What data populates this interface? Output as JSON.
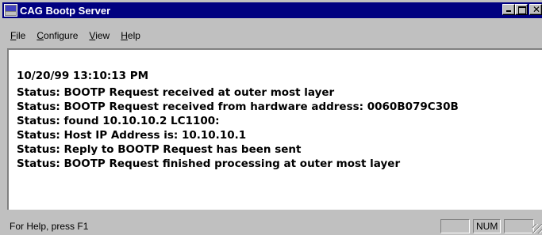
{
  "window": {
    "title": "CAG Bootp Server",
    "icon": "app-icon",
    "controls": {
      "minimize_icon": "minimize-icon",
      "maximize_icon": "maximize-icon",
      "close_label": "✕"
    }
  },
  "menu": {
    "items": [
      {
        "accel": "F",
        "rest": "ile"
      },
      {
        "accel": "C",
        "rest": "onfigure"
      },
      {
        "accel": "V",
        "rest": "iew"
      },
      {
        "accel": "H",
        "rest": "elp"
      }
    ]
  },
  "log": {
    "timestamp": "10/20/99 13:10:13 PM",
    "lines": [
      "Status: BOOTP Request received at outer most layer",
      "Status: BOOTP Request received from hardware address: 0060B079C30B",
      "Status: found 10.10.10.2 LC1100:",
      "Status: Host IP Address is: 10.10.10.1",
      "Status: Reply to BOOTP Request has been sent",
      "Status: BOOTP Request finished processing at outer most layer"
    ]
  },
  "statusbar": {
    "text": "For Help, press F1",
    "pane1": "",
    "pane2": "NUM",
    "pane3": ""
  },
  "colors": {
    "titlebar": "#000080",
    "face": "#c0c0c0",
    "client": "#ffffff"
  }
}
